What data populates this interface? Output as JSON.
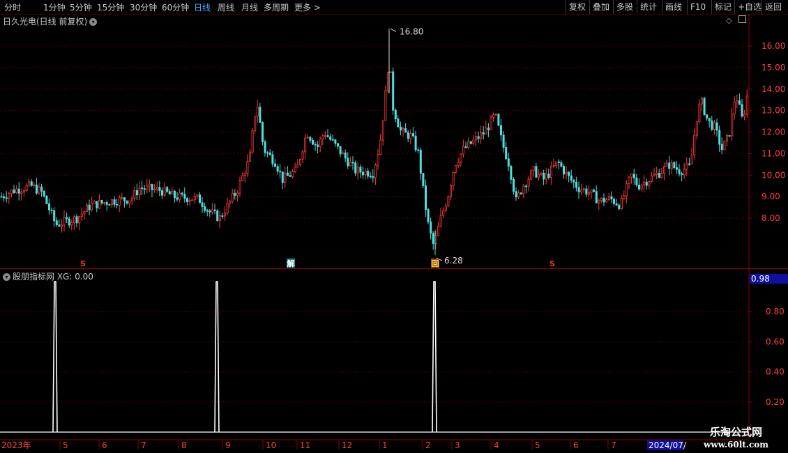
{
  "toolbar": {
    "periods": [
      "分时",
      "1分钟",
      "5分钟",
      "15分钟",
      "30分钟",
      "60分钟",
      "日线",
      "周线",
      "月线",
      "多周期",
      "更多 >"
    ],
    "active_period": "日线",
    "right_buttons": [
      "复权",
      "叠加",
      "多股",
      "统计",
      "画线",
      "F10",
      "标记",
      "+自选",
      "返回"
    ]
  },
  "stock": {
    "title": "日久光电(日线 前复权)",
    "price_labels": [
      "16.00",
      "15.00",
      "14.00",
      "13.00",
      "12.00",
      "11.00",
      "10.00",
      "9.00",
      "8.00"
    ],
    "high_label": "16.80",
    "low_label": "6.28",
    "marker_labels": [
      "S",
      "解",
      "回",
      "S"
    ]
  },
  "indicator": {
    "title": "股朋指标网 XG: 0.00",
    "current_value": "0.98",
    "axis_labels": [
      "0.80",
      "0.60",
      "0.40",
      "0.20"
    ]
  },
  "time_axis": {
    "start_label": "2023年",
    "months": [
      "5",
      "6",
      "7",
      "8",
      "9",
      "10",
      "11",
      "12",
      "1",
      "2",
      "3",
      "4",
      "5",
      "6",
      "7"
    ],
    "end_label": "2024/07/"
  },
  "watermark": {
    "line1": "乐淘公式网",
    "line2": "www.60lt.com"
  },
  "colors": {
    "up": "#ff3b3b",
    "down": "#4ee0e0",
    "grid": "#8b0000",
    "axis_text": "#ff4040",
    "active": "#4aa8ff",
    "indicator_line": "#ffffff"
  },
  "chart_data": [
    {
      "type": "candlestick",
      "title": "日久光电(日线 前复权)",
      "y_axis": {
        "ticks": [
          8,
          9,
          10,
          11,
          12,
          13,
          14,
          15,
          16
        ],
        "range": [
          6.28,
          16.8
        ]
      },
      "x": [
        "2023-04",
        "2023-05",
        "2023-06",
        "2023-07",
        "2023-08",
        "2023-09",
        "2023-10",
        "2023-11",
        "2023-12",
        "2024-01",
        "2024-02",
        "2024-03",
        "2024-04",
        "2024-05",
        "2024-06",
        "2024-07"
      ],
      "close_approx": [
        9.1,
        8.0,
        8.7,
        9.2,
        9.0,
        8.2,
        11.0,
        12.0,
        10.5,
        12.8,
        7.0,
        11.5,
        10.5,
        10.0,
        9.0,
        13.8
      ],
      "annotations": [
        {
          "label": "16.80",
          "type": "max"
        },
        {
          "label": "6.28",
          "type": "min"
        }
      ]
    },
    {
      "type": "line",
      "title": "股朋指标网",
      "series": [
        {
          "name": "XG",
          "values": [
            0,
            1,
            0,
            1,
            0,
            1,
            0
          ]
        }
      ],
      "events": [
        "2023-05",
        "2023-09",
        "2024-02"
      ],
      "y_axis": {
        "ticks": [
          0.2,
          0.4,
          0.6,
          0.8
        ],
        "range": [
          0,
          1
        ]
      },
      "current": 0.0
    }
  ]
}
